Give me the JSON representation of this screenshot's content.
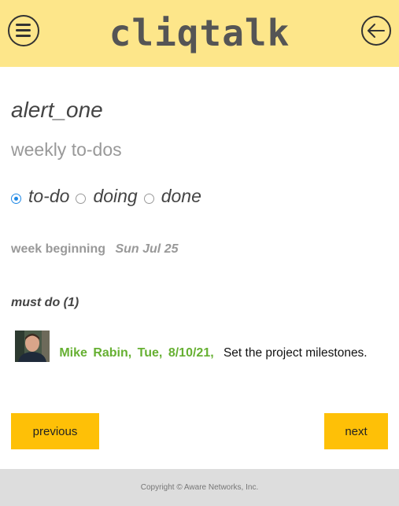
{
  "header": {
    "logo": "cliqtalk",
    "menu_icon": "hamburger-menu-icon",
    "back_icon": "arrow-left-icon"
  },
  "alert": {
    "name": "alert_one",
    "subtitle": "weekly to-dos"
  },
  "status_options": [
    {
      "label": "to-do",
      "selected": true
    },
    {
      "label": "doing",
      "selected": false
    },
    {
      "label": "done",
      "selected": false
    }
  ],
  "week": {
    "label": "week beginning",
    "date": "Sun Jul 25"
  },
  "section": {
    "title": "must do (1)"
  },
  "entries": [
    {
      "author": "Mike Rabin,",
      "day": "Tue,",
      "date": "8/10/21,",
      "text": "Set the project milestones."
    }
  ],
  "nav": {
    "previous": "previous",
    "next": "next"
  },
  "footer": {
    "copyright": "Copyright © Aware Networks, Inc."
  },
  "colors": {
    "header_bg": "#fde68a",
    "button_bg": "#fec007",
    "meta_green": "#66b032",
    "radio_blue": "#1e88e5",
    "footer_bg": "#dddddd"
  }
}
